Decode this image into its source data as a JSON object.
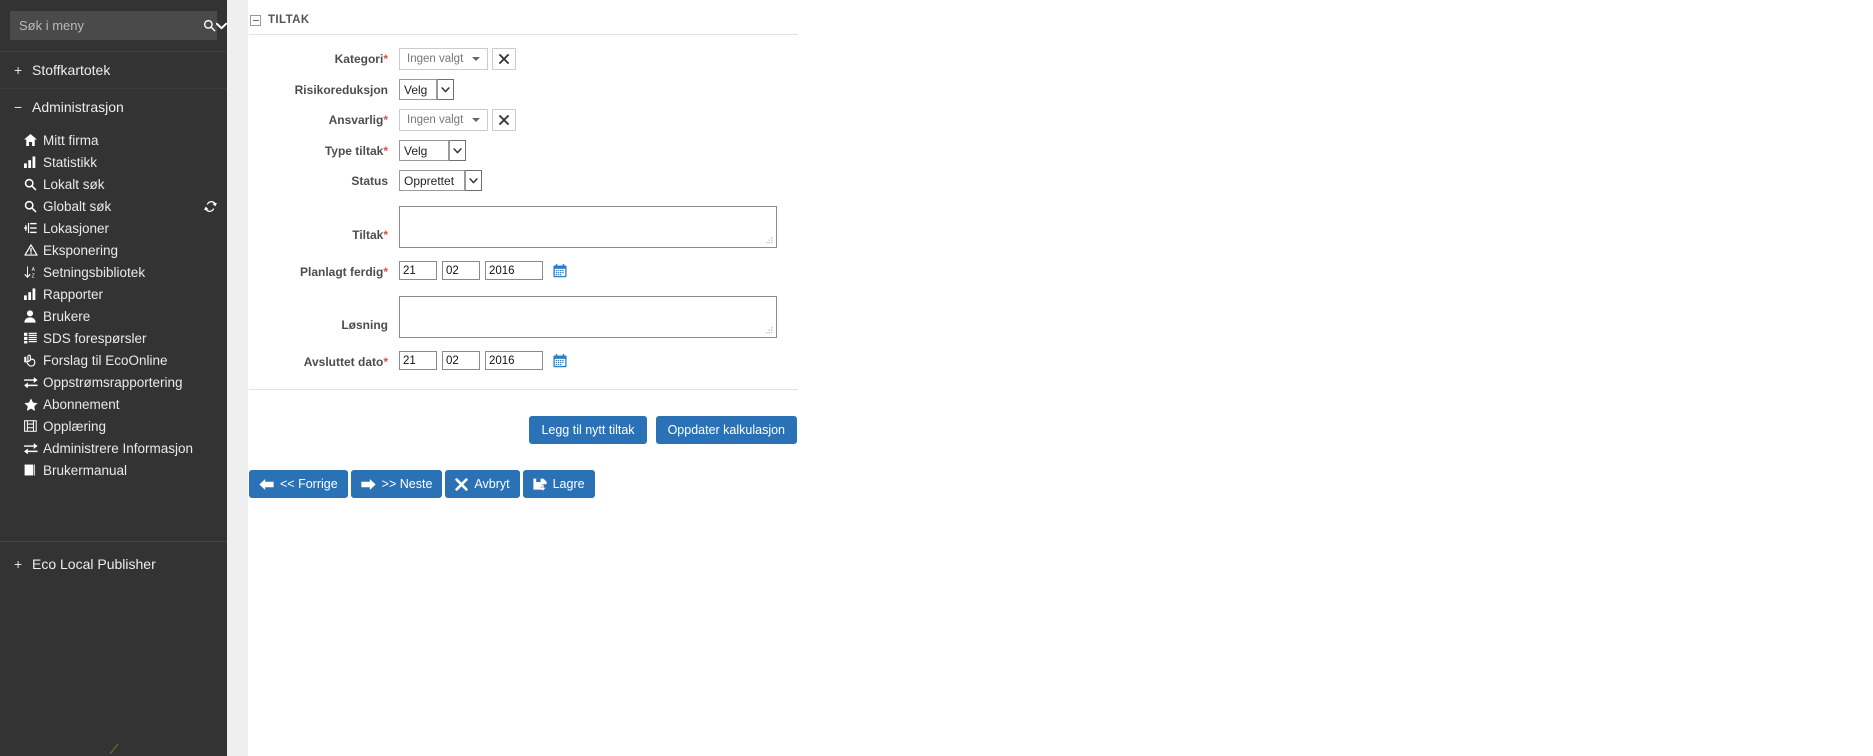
{
  "sidebar": {
    "search": {
      "placeholder": "Søk i meny",
      "value": "",
      "search_icon": "search-icon",
      "caret_icon": "chevron-down-icon"
    },
    "groups": [
      {
        "label": "Stoffkartotek",
        "toggle": "+",
        "items": []
      },
      {
        "label": "Administrasjon",
        "toggle": "−",
        "items": [
          {
            "label": "Mitt firma",
            "icon": "home-icon"
          },
          {
            "label": "Statistikk",
            "icon": "bar-chart-icon"
          },
          {
            "label": "Lokalt søk",
            "icon": "search-icon"
          },
          {
            "label": "Globalt søk",
            "icon": "search-icon",
            "trailing_icon": "sync-icon"
          },
          {
            "label": "Lokasjoner",
            "icon": "sitemap-icon"
          },
          {
            "label": "Eksponering",
            "icon": "warning-triangle-icon"
          },
          {
            "label": "Setningsbibliotek",
            "icon": "sort-alpha-icon"
          },
          {
            "label": "Rapporter",
            "icon": "bar-chart-icon"
          },
          {
            "label": "Brukere",
            "icon": "user-icon"
          },
          {
            "label": "SDS forespørsler",
            "icon": "list-icon"
          },
          {
            "label": "Forslag til EcoOnline",
            "icon": "hand-pointer-icon"
          },
          {
            "label": "Oppstrømsrapportering",
            "icon": "exchange-icon"
          },
          {
            "label": "Abonnement",
            "icon": "star-icon"
          },
          {
            "label": "Opplæring",
            "icon": "film-icon"
          },
          {
            "label": "Administrere Informasjon",
            "icon": "exchange-icon"
          },
          {
            "label": "Brukermanual",
            "icon": "book-icon"
          }
        ]
      },
      {
        "label": "Eco Local Publisher",
        "toggle": "+",
        "items": []
      }
    ]
  },
  "panel": {
    "title": "TILTAK",
    "collapse_icon": "minus-square-icon"
  },
  "form": {
    "fields": {
      "kategori": {
        "label": "Kategori",
        "required": true,
        "value": "Ingen valgt",
        "clear_icon": "times-icon"
      },
      "risikoreduksjon": {
        "label": "Risikoreduksjon",
        "required": false,
        "value": "Velg",
        "options": [
          "Velg"
        ]
      },
      "ansvarlig": {
        "label": "Ansvarlig",
        "required": true,
        "value": "Ingen valgt",
        "clear_icon": "times-icon"
      },
      "type_tiltak": {
        "label": "Type tiltak",
        "required": true,
        "value": "Velg",
        "options": [
          "Velg"
        ]
      },
      "status": {
        "label": "Status",
        "required": false,
        "value": "Opprettet",
        "options": [
          "Opprettet"
        ]
      },
      "tiltak": {
        "label": "Tiltak",
        "required": true,
        "value": ""
      },
      "planlagt_ferdig": {
        "label": "Planlagt ferdig",
        "required": true,
        "day": "21",
        "month": "02",
        "year": "2016",
        "calendar_icon": "calendar-icon"
      },
      "losning": {
        "label": "Løsning",
        "required": false,
        "value": ""
      },
      "avsluttet_dato": {
        "label": "Avsluttet dato",
        "required": true,
        "day": "21",
        "month": "02",
        "year": "2016",
        "calendar_icon": "calendar-icon"
      }
    }
  },
  "actions": {
    "add_tiltak": "Legg til nytt tiltak",
    "update_calc": "Oppdater kalkulasjon",
    "prev": "<< Forrige",
    "next": ">> Neste",
    "cancel": "Avbryt",
    "save": "Lagre"
  },
  "colors": {
    "sidebar_bg": "#333333",
    "primary": "#2a72b5",
    "required": "#d9534f",
    "gutter": "#efefef",
    "calendar_icon": "#2a7fc9"
  }
}
